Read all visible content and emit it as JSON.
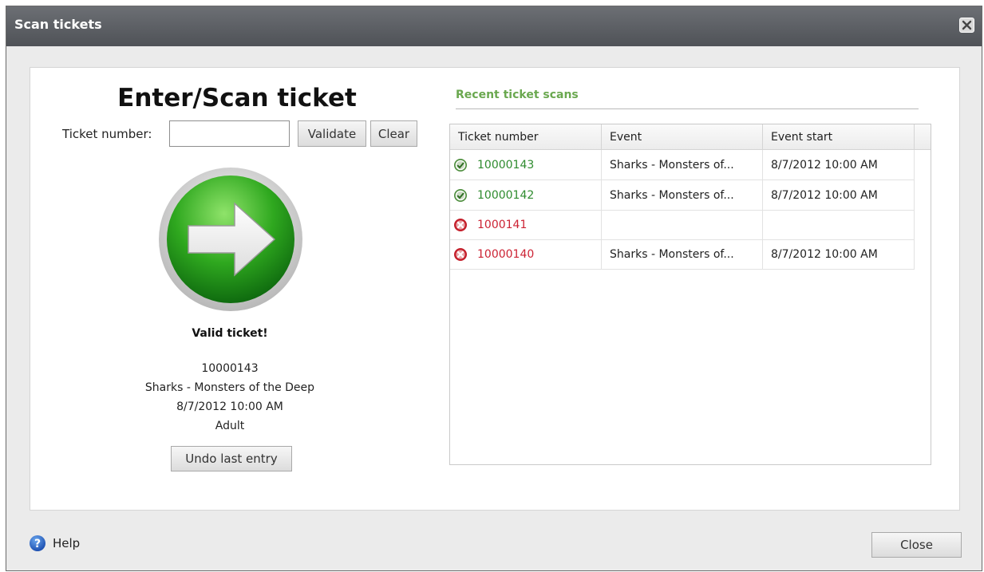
{
  "window": {
    "title": "Scan tickets"
  },
  "scan": {
    "heading": "Enter/Scan ticket",
    "ticket_label": "Ticket number:",
    "ticket_value": "",
    "validate_label": "Validate",
    "clear_label": "Clear"
  },
  "result": {
    "status": "Valid ticket!",
    "ticket_number": "10000143",
    "event": "Sharks - Monsters of the Deep",
    "event_start": "8/7/2012 10:00 AM",
    "price_type": "Adult",
    "undo_label": "Undo last entry",
    "icon": "green-arrow-icon"
  },
  "recent": {
    "title": "Recent ticket scans",
    "columns": [
      "Ticket number",
      "Event",
      "Event start"
    ],
    "rows": [
      {
        "ticket": "10000143",
        "event": "Sharks - Monsters of...",
        "start": "8/7/2012 10:00 AM",
        "status": "valid"
      },
      {
        "ticket": "10000142",
        "event": "Sharks - Monsters of...",
        "start": "8/7/2012 10:00 AM",
        "status": "valid"
      },
      {
        "ticket": "1000141",
        "event": "",
        "start": "",
        "status": "invalid"
      },
      {
        "ticket": "10000140",
        "event": "Sharks - Monsters of...",
        "start": "8/7/2012 10:00 AM",
        "status": "invalid"
      }
    ]
  },
  "footer": {
    "help_label": "Help",
    "close_label": "Close"
  },
  "colors": {
    "valid": "#2e8b2e",
    "invalid": "#cc2233",
    "section_title": "#6aa84f"
  }
}
